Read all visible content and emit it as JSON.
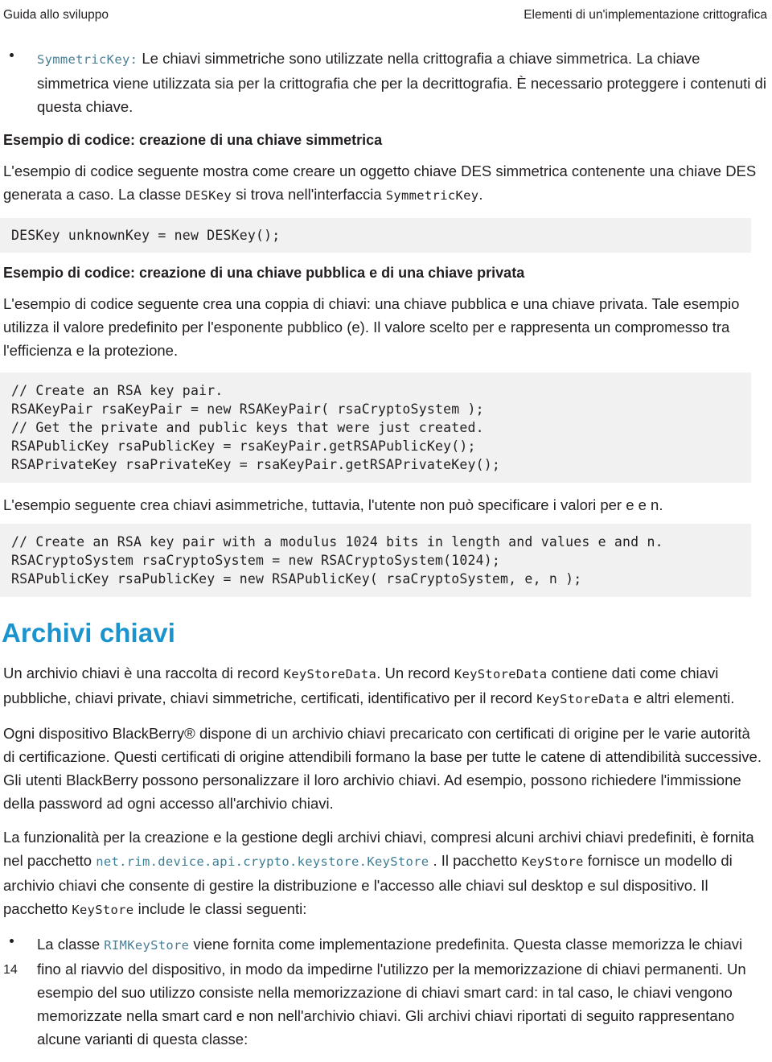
{
  "header": {
    "left": "Guida allo sviluppo",
    "right": "Elementi di un'implementazione crittografica"
  },
  "bullet_symmetric": {
    "code_label": "SymmetricKey:",
    "text": " Le chiavi simmetriche sono utilizzate nella crittografia a chiave simmetrica. La chiave simmetrica viene utilizzata sia per la crittografia che per la decrittografia. È necessario proteggere i contenuti di questa chiave."
  },
  "section_symmetric": {
    "heading": "Esempio di codice: creazione di una chiave simmetrica",
    "para_part1": "L'esempio di codice seguente mostra come creare un oggetto chiave DES simmetrica contenente una chiave DES generata a caso. La classe ",
    "para_code1": "DESKey",
    "para_part2": " si trova nell'interfaccia ",
    "para_code2": "SymmetricKey",
    "para_part3": ".",
    "code": "DESKey unknownKey = new DESKey();"
  },
  "section_keypair": {
    "heading": "Esempio di codice: creazione di una chiave pubblica e di una chiave privata",
    "para": "L'esempio di codice seguente crea una coppia di chiavi: una chiave pubblica e una chiave privata. Tale esempio utilizza il valore predefinito per l'esponente pubblico (e). Il valore scelto per e rappresenta un compromesso tra l'efficienza e la protezione.",
    "code": "// Create an RSA key pair.\nRSAKeyPair rsaKeyPair = new RSAKeyPair( rsaCryptoSystem );\n// Get the private and public keys that were just created.\nRSAPublicKey rsaPublicKey = rsaKeyPair.getRSAPublicKey();\nRSAPrivateKey rsaPrivateKey = rsaKeyPair.getRSAPrivateKey();"
  },
  "section_asymmetric": {
    "para": "L'esempio seguente crea chiavi asimmetriche, tuttavia, l'utente non può specificare i valori per e e n.",
    "code": "// Create an RSA key pair with a modulus 1024 bits in length and values e and n.\nRSACryptoSystem rsaCryptoSystem = new RSACryptoSystem(1024);\nRSAPublicKey rsaPublicKey = new RSAPublicKey( rsaCryptoSystem, e, n );"
  },
  "section_keystores": {
    "heading": "Archivi chiavi",
    "para1_a": "Un archivio chiavi è una raccolta di record ",
    "para1_code1": "KeyStoreData",
    "para1_b": ". Un record ",
    "para1_code2": "KeyStoreData",
    "para1_c": " contiene dati come chiavi pubbliche, chiavi private, chiavi simmetriche, certificati, identificativo per il record ",
    "para1_code3": "KeyStoreData",
    "para1_d": " e altri elementi.",
    "para2": "Ogni dispositivo BlackBerry® dispone di un archivio chiavi precaricato con certificati di origine per le varie autorità di certificazione. Questi certificati di origine attendibili formano la base per tutte le catene di attendibilità successive. Gli utenti BlackBerry possono personalizzare il loro archivio chiavi. Ad esempio, possono richiedere l'immissione della password ad ogni accesso all'archivio chiavi.",
    "para3_a": "La funzionalità per la creazione e la gestione degli archivi chiavi, compresi alcuni archivi chiavi predefiniti, è fornita nel pacchetto ",
    "para3_code1": "net.rim.device.api.crypto.keystore.KeyStore",
    "para3_b": " . Il pacchetto ",
    "para3_code2": "KeyStore",
    "para3_c": " fornisce un modello di archivio chiavi che consente di gestire la distribuzione e l'accesso alle chiavi sul desktop e sul dispositivo. Il pacchetto ",
    "para3_code3": "KeyStore",
    "para3_d": " include le classi seguenti:",
    "bullet1_a": "La classe ",
    "bullet1_code": "RIMKeyStore",
    "bullet1_b": " viene fornita come implementazione predefinita. Questa classe memorizza le chiavi fino al riavvio del dispositivo, in modo da impedirne l'utilizzo per la memorizzazione di chiavi permanenti. Un esempio del suo utilizzo consiste nella memorizzazione di chiavi smart card: in tal caso, le chiavi vengono memorizzate nella smart card e non nell'archivio chiavi. Gli archivi chiavi riportati di seguito rappresentano alcune varianti di questa classe:"
  },
  "footer": {
    "page_number": "14"
  },
  "colors": {
    "accent_blue": "#1b94ce",
    "code_teal": "#4a7f96",
    "code_block_bg": "#f1f1f1",
    "body_text": "#231f20"
  }
}
